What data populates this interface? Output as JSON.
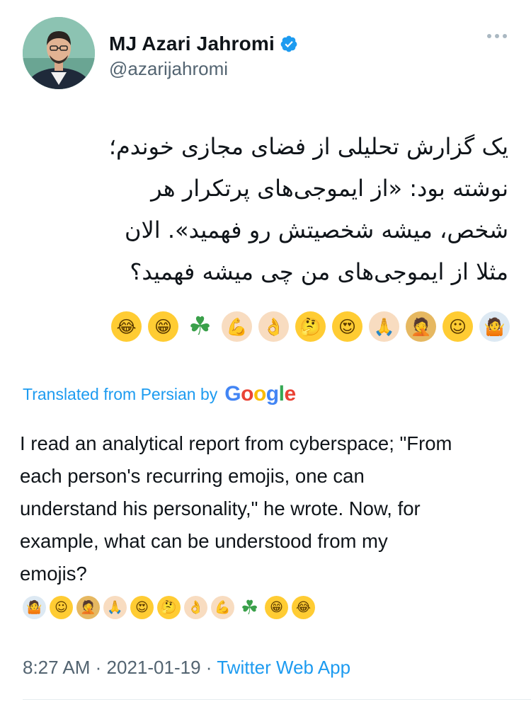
{
  "tweet": {
    "author": {
      "display_name": "MJ Azari Jahromi",
      "handle": "@azarijahromi",
      "verified": true
    },
    "persian_lines": [
      "یک گزارش تحلیلی از فضای مجازی خوندم؛",
      "نوشته بود: «از ایموجی‌های پرتکرار هر",
      "شخص، میشه شخصیتش رو فهمید». الان",
      "مثلا از ایموجی‌های من چی میشه فهمید؟"
    ],
    "emojis_persian_order": [
      "face-with-tears-of-joy",
      "grinning-face-with-smiling-eyes",
      "four-leaf-clover",
      "flexed-biceps",
      "ok-hand",
      "thinking-face",
      "smiling-face-with-heart-eyes",
      "folded-hands",
      "man-facepalming",
      "smiling-face-with-smiling-eyes",
      "man-shrugging"
    ],
    "translation_label": "Translated from Persian by",
    "translation_provider": "Google",
    "english_lines": [
      "I read an analytical report from cyberspace; \"From",
      "each person's recurring emojis, one can",
      "understand his personality,\" he wrote. Now, for",
      "example, what can be understood from my",
      "emojis?"
    ],
    "emojis_english_order": [
      "man-shrugging",
      "smiling-face-with-smiling-eyes",
      "man-facepalming",
      "folded-hands",
      "smiling-face-with-heart-eyes",
      "thinking-face",
      "ok-hand",
      "flexed-biceps",
      "four-leaf-clover",
      "grinning-face-with-smiling-eyes",
      "face-with-tears-of-joy"
    ],
    "time": "8:27 AM",
    "date": "2021-01-19",
    "separator": "·",
    "source": "Twitter Web App"
  },
  "colors": {
    "link": "#1d9bf0",
    "secondary_text": "#536471",
    "verified": "#1d9bf0"
  }
}
